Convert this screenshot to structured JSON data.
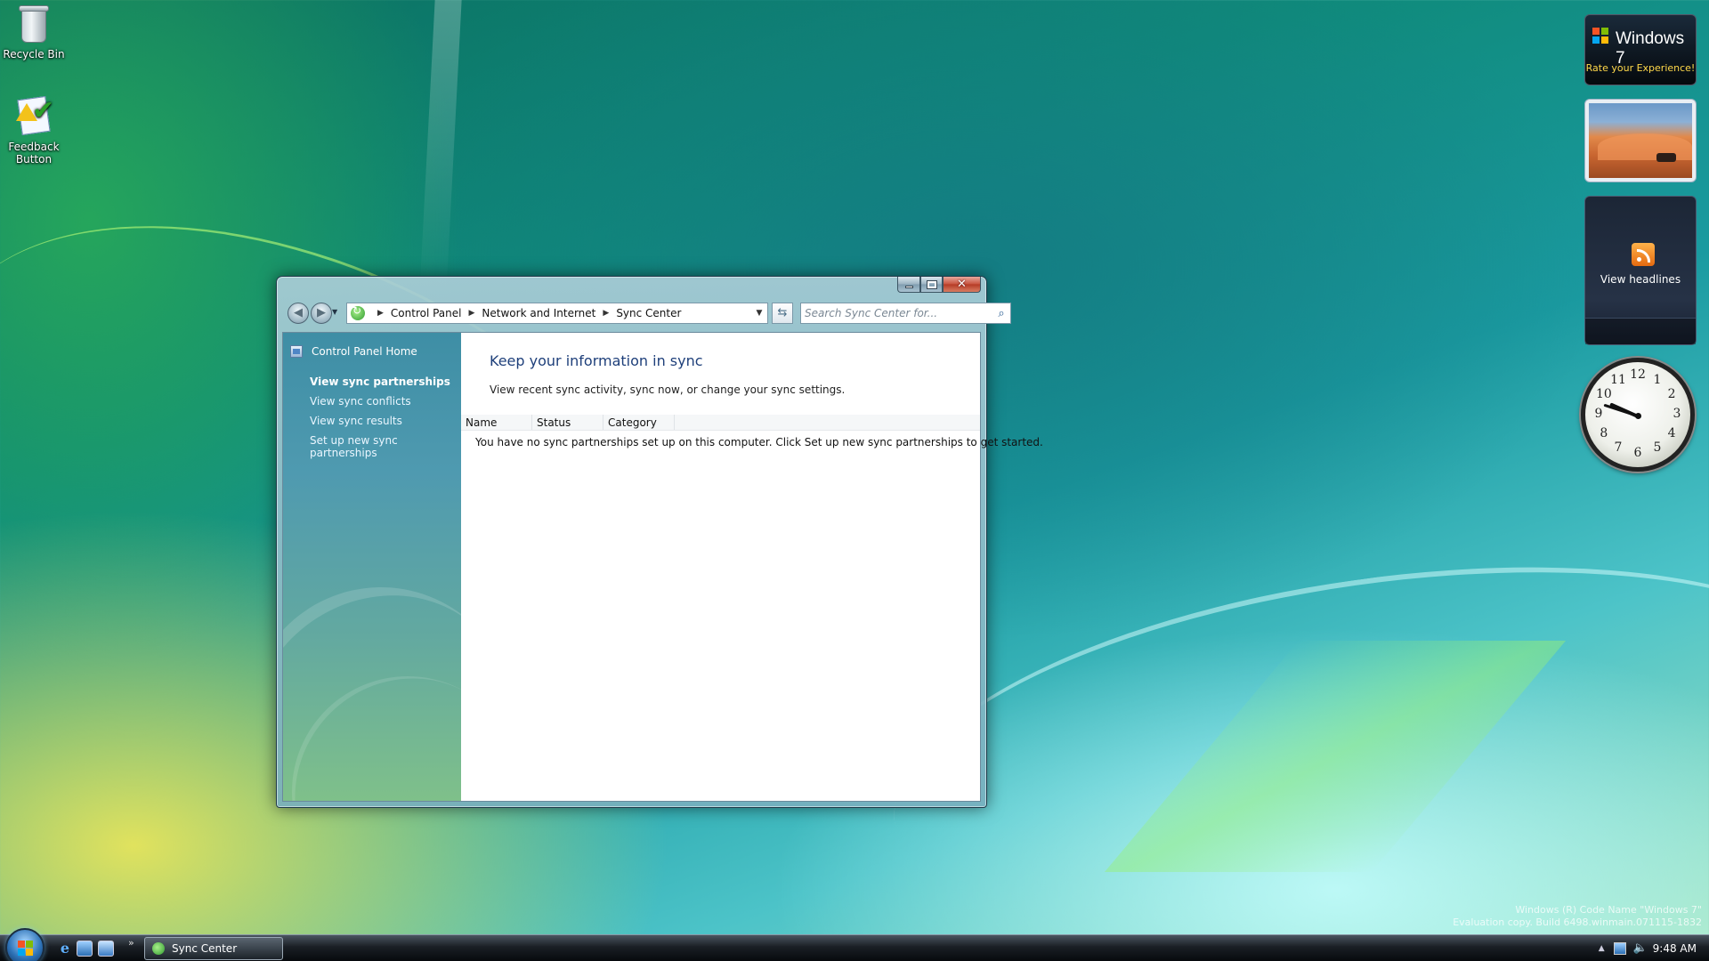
{
  "desktop": {
    "icons": [
      {
        "label": "Recycle Bin"
      },
      {
        "label": "Feedback Button"
      }
    ]
  },
  "gadgets": {
    "win7": {
      "title": "Windows 7",
      "subtitle": "Rate your Experience!"
    },
    "feed": {
      "label": "View headlines"
    },
    "clock": {
      "numbers": [
        "12",
        "1",
        "2",
        "3",
        "4",
        "5",
        "6",
        "7",
        "8",
        "9",
        "10",
        "11"
      ]
    }
  },
  "window": {
    "address": {
      "crumbs": [
        "Control Panel",
        "Network and Internet",
        "Sync Center"
      ]
    },
    "search": {
      "placeholder": "Search Sync Center for..."
    },
    "sidebar": {
      "home": "Control Panel Home",
      "links": [
        "View sync partnerships",
        "View sync conflicts",
        "View sync results",
        "Set up new sync partnerships"
      ]
    },
    "content": {
      "heading": "Keep your information in sync",
      "description": "View recent sync activity, sync now, or change your sync settings.",
      "columns": [
        "Name",
        "Status",
        "Category"
      ],
      "empty_message": "You have no sync partnerships set up on this computer. Click Set up new sync partnerships to get started."
    }
  },
  "taskbar": {
    "task": "Sync Center",
    "time": "9:48 AM"
  },
  "watermark": {
    "line1": "Windows (R) Code Name \"Windows 7\"",
    "line2": "Evaluation copy. Build 6498.winmain.071115-1832"
  },
  "colors": {
    "heading": "#1e3f7a",
    "sidebar_top": "#3e8ea5",
    "sidebar_bottom": "#7fc08a",
    "close_button": "#c7513d"
  }
}
